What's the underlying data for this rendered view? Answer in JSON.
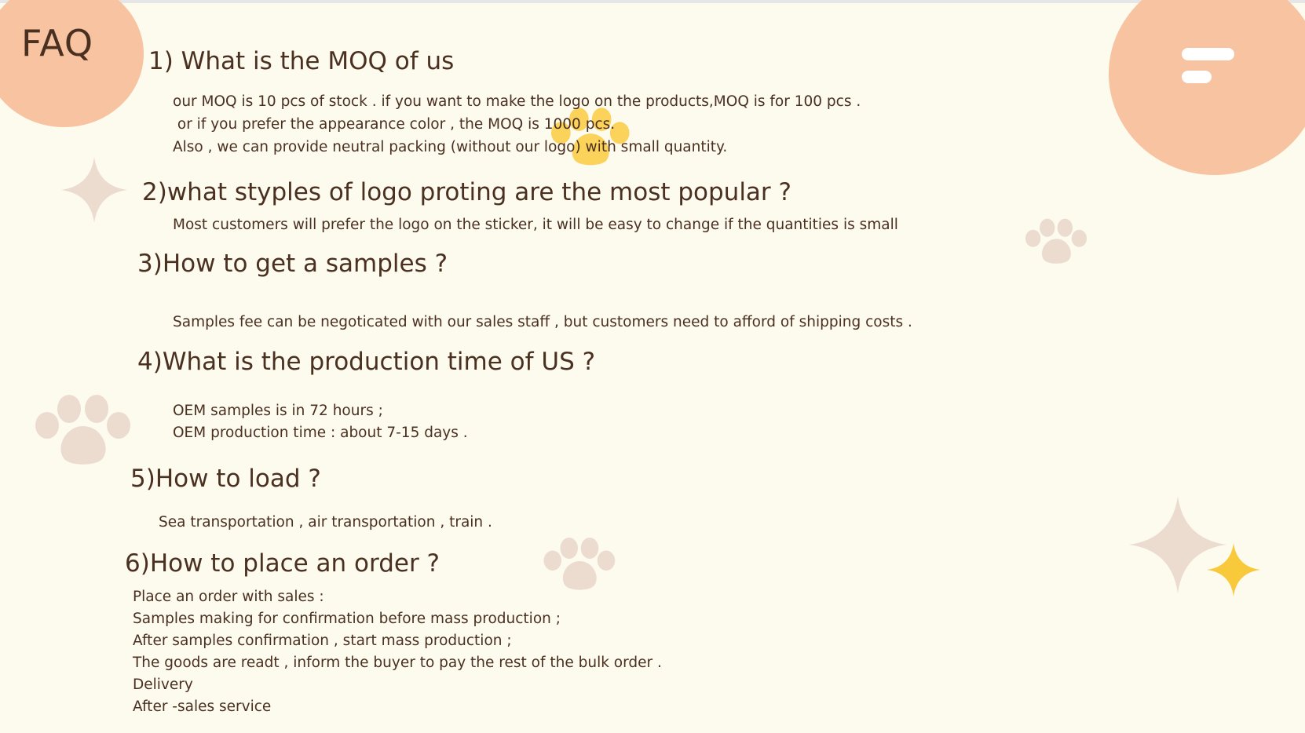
{
  "title": "FAQ",
  "faq": [
    {
      "question": "1) What is the MOQ of  us",
      "answer": [
        "our MOQ is 10 pcs of stock . if you want to make the logo on the products,MOQ is for 100 pcs .",
        " or if you prefer the appearance color , the MOQ is 1000 pcs.",
        "Also , we can provide neutral packing (without our logo) with small quantity."
      ]
    },
    {
      "question": "2)what styples of logo proting are the most popular ?",
      "answer": [
        "Most customers will prefer the logo on the sticker, it will be easy to change if the quantities is small"
      ]
    },
    {
      "question": "3)How to get a samples ?",
      "answer": [
        "Samples fee can be negoticated with our sales staff , but customers need to afford of shipping costs ."
      ]
    },
    {
      "question": "4)What is the production time of  US ?",
      "answer": [
        "OEM samples is in 72 hours ;",
        "OEM production time : about 7-15 days ."
      ]
    },
    {
      "question": "5)How to load ?",
      "answer": [
        "Sea transportation , air transportation , train ."
      ]
    },
    {
      "question": "6)How to place an order ?",
      "answer": [
        "Place an order with sales :",
        "Samples making for confirmation before mass production ;",
        "After samples confirmation , start mass production ;",
        "The goods are readt , inform the buyer to pay the rest of the bulk order .",
        "Delivery",
        "After -sales service"
      ]
    }
  ],
  "icons": [
    "menu-icon",
    "paw-icon",
    "sparkle-icon"
  ],
  "colors": {
    "background": "#fdfaee",
    "accent_peach": "#f7c3a0",
    "text_brown": "#4a3020",
    "paw_beige": "#ecdcd0",
    "paw_yellow": "#fbd35a",
    "star_gold": "#f8c93a"
  }
}
